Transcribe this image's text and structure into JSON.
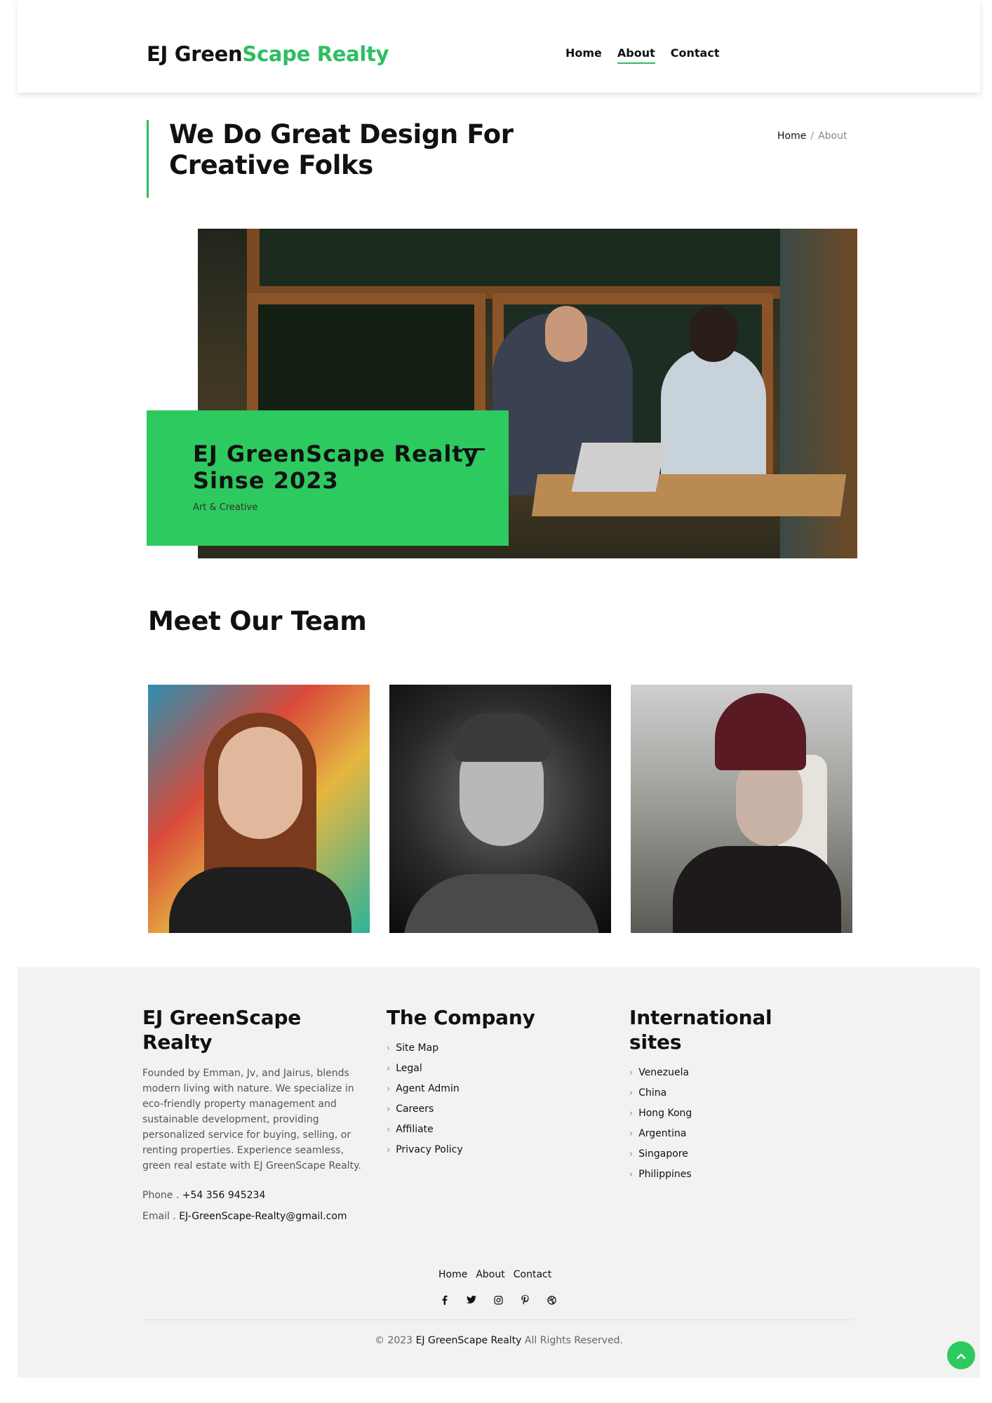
{
  "header": {
    "logo_part1": "EJ Green",
    "logo_part2": "Scape Realty",
    "nav": [
      {
        "label": "Home"
      },
      {
        "label": "About",
        "active": true
      },
      {
        "label": "Contact"
      }
    ]
  },
  "page_title": "We Do Great Design For Creative Folks",
  "breadcrumb": {
    "home": "Home",
    "separator": "/",
    "current": "About"
  },
  "hero": {
    "card_title": "EJ GreenScape Realty Sinse 2023",
    "card_subtitle": "Art & Creative"
  },
  "team": {
    "heading": "Meet Our Team"
  },
  "footer": {
    "about": {
      "heading": "EJ GreenScape Realty",
      "text": "Founded by Emman, Jv, and Jairus, blends modern living with nature. We specialize in eco-friendly property management and sustainable development, providing personalized service for buying, selling, or renting properties. Experience seamless, green real estate with EJ GreenScape Realty.",
      "phone_label": "Phone .",
      "phone": "+54 356 945234",
      "email_label": "Email .",
      "email": "EJ-GreenScape-Realty@gmail.com"
    },
    "company": {
      "heading": "The Company",
      "links": [
        "Site Map",
        "Legal",
        "Agent Admin",
        "Careers",
        "Affiliate",
        "Privacy Policy"
      ]
    },
    "international": {
      "heading": "International sites",
      "links": [
        "Venezuela",
        "China",
        "Hong Kong",
        "Argentina",
        "Singapore",
        "Philippines"
      ]
    },
    "nav": [
      "Home",
      "About",
      "Contact"
    ],
    "social_icons": [
      "facebook-icon",
      "twitter-icon",
      "instagram-icon",
      "pinterest-icon",
      "dribbble-icon"
    ],
    "copyright_prefix": "© 2023",
    "copyright_brand": "EJ GreenScape Realty",
    "copyright_suffix": "All Rights Reserved."
  },
  "colors": {
    "accent": "#2dbe60",
    "card": "#2dca5f",
    "footer_bg": "#f2f2f2"
  }
}
